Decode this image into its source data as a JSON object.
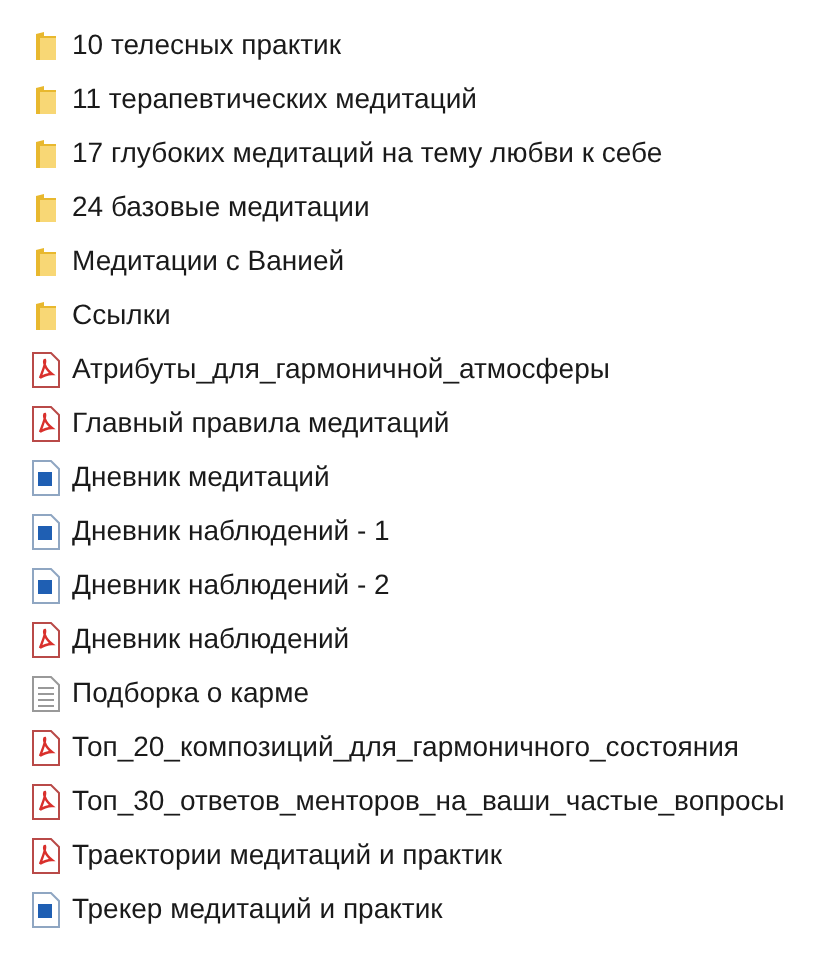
{
  "files": [
    {
      "kind": "folder",
      "name": "10 телесных практик"
    },
    {
      "kind": "folder",
      "name": "11 терапевтических медитаций"
    },
    {
      "kind": "folder",
      "name": "17 глубоких медитаций на тему любви к себе"
    },
    {
      "kind": "folder",
      "name": "24 базовые медитации"
    },
    {
      "kind": "folder",
      "name": "Медитации с Ванией"
    },
    {
      "kind": "folder",
      "name": "Ссылки"
    },
    {
      "kind": "pdf",
      "name": "Атрибуты_для_гармоничной_атмосферы"
    },
    {
      "kind": "pdf",
      "name": "Главный правила медитаций"
    },
    {
      "kind": "doc",
      "name": "Дневник медитаций"
    },
    {
      "kind": "doc",
      "name": "Дневник наблюдений - 1"
    },
    {
      "kind": "doc",
      "name": "Дневник наблюдений - 2"
    },
    {
      "kind": "pdf",
      "name": "Дневник наблюдений"
    },
    {
      "kind": "txt",
      "name": "Подборка о карме"
    },
    {
      "kind": "pdf",
      "name": "Топ_20_композиций_для_гармоничного_состояния"
    },
    {
      "kind": "pdf",
      "name": "Топ_30_ответов_менторов_на_ваши_частые_вопросы"
    },
    {
      "kind": "pdf",
      "name": "Траектории медитаций и практик"
    },
    {
      "kind": "doc",
      "name": "Трекер медитаций и практик"
    }
  ]
}
